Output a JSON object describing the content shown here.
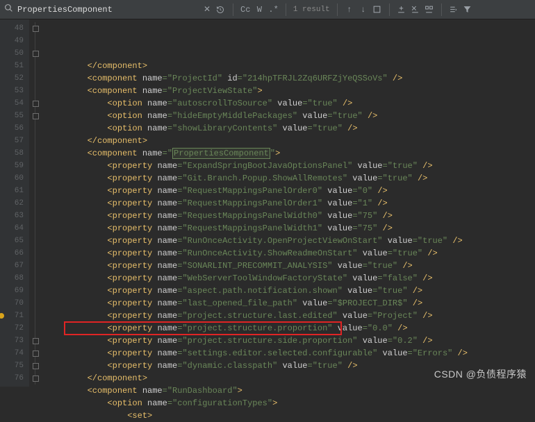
{
  "toolbar": {
    "search_value": "PropertiesComponent",
    "case_label": "Cc",
    "word_label": "W",
    "regex_label": ".*",
    "results": "1 result"
  },
  "gutter": {
    "start": 48,
    "end": 76,
    "breakpoint_line": 71
  },
  "code_lines": [
    {
      "indent": 4,
      "kind": "close",
      "tag": "component"
    },
    {
      "indent": 4,
      "kind": "self",
      "tag": "component",
      "attrs": [
        [
          "name",
          "ProjectId"
        ],
        [
          "id",
          "214hpTFRJL2Zq6URFZjYeQSSoVs"
        ]
      ]
    },
    {
      "indent": 4,
      "kind": "open",
      "tag": "component",
      "attrs": [
        [
          "name",
          "ProjectViewState"
        ]
      ]
    },
    {
      "indent": 6,
      "kind": "self",
      "tag": "option",
      "attrs": [
        [
          "name",
          "autoscrollToSource"
        ],
        [
          "value",
          "true"
        ]
      ]
    },
    {
      "indent": 6,
      "kind": "self",
      "tag": "option",
      "attrs": [
        [
          "name",
          "hideEmptyMiddlePackages"
        ],
        [
          "value",
          "true"
        ]
      ]
    },
    {
      "indent": 6,
      "kind": "self",
      "tag": "option",
      "attrs": [
        [
          "name",
          "showLibraryContents"
        ],
        [
          "value",
          "true"
        ]
      ]
    },
    {
      "indent": 4,
      "kind": "close",
      "tag": "component"
    },
    {
      "indent": 4,
      "kind": "open",
      "tag": "component",
      "attrs": [
        [
          "name",
          "PropertiesComponent"
        ]
      ],
      "highlight_attr_value": 0
    },
    {
      "indent": 6,
      "kind": "self",
      "tag": "property",
      "attrs": [
        [
          "name",
          "ExpandSpringBootJavaOptionsPanel"
        ],
        [
          "value",
          "true"
        ]
      ]
    },
    {
      "indent": 6,
      "kind": "self",
      "tag": "property",
      "attrs": [
        [
          "name",
          "Git.Branch.Popup.ShowAllRemotes"
        ],
        [
          "value",
          "true"
        ]
      ]
    },
    {
      "indent": 6,
      "kind": "self",
      "tag": "property",
      "attrs": [
        [
          "name",
          "RequestMappingsPanelOrder0"
        ],
        [
          "value",
          "0"
        ]
      ]
    },
    {
      "indent": 6,
      "kind": "self",
      "tag": "property",
      "attrs": [
        [
          "name",
          "RequestMappingsPanelOrder1"
        ],
        [
          "value",
          "1"
        ]
      ]
    },
    {
      "indent": 6,
      "kind": "self",
      "tag": "property",
      "attrs": [
        [
          "name",
          "RequestMappingsPanelWidth0"
        ],
        [
          "value",
          "75"
        ]
      ]
    },
    {
      "indent": 6,
      "kind": "self",
      "tag": "property",
      "attrs": [
        [
          "name",
          "RequestMappingsPanelWidth1"
        ],
        [
          "value",
          "75"
        ]
      ]
    },
    {
      "indent": 6,
      "kind": "self",
      "tag": "property",
      "attrs": [
        [
          "name",
          "RunOnceActivity.OpenProjectViewOnStart"
        ],
        [
          "value",
          "true"
        ]
      ]
    },
    {
      "indent": 6,
      "kind": "self",
      "tag": "property",
      "attrs": [
        [
          "name",
          "RunOnceActivity.ShowReadmeOnStart"
        ],
        [
          "value",
          "true"
        ]
      ]
    },
    {
      "indent": 6,
      "kind": "self",
      "tag": "property",
      "attrs": [
        [
          "name",
          "SONARLINT_PRECOMMIT_ANALYSIS"
        ],
        [
          "value",
          "true"
        ]
      ]
    },
    {
      "indent": 6,
      "kind": "self",
      "tag": "property",
      "attrs": [
        [
          "name",
          "WebServerToolWindowFactoryState"
        ],
        [
          "value",
          "false"
        ]
      ]
    },
    {
      "indent": 6,
      "kind": "self",
      "tag": "property",
      "attrs": [
        [
          "name",
          "aspect.path.notification.shown"
        ],
        [
          "value",
          "true"
        ]
      ]
    },
    {
      "indent": 6,
      "kind": "self",
      "tag": "property",
      "attrs": [
        [
          "name",
          "last_opened_file_path"
        ],
        [
          "value",
          "$PROJECT_DIR$"
        ]
      ]
    },
    {
      "indent": 6,
      "kind": "self",
      "tag": "property",
      "attrs": [
        [
          "name",
          "project.structure.last.edited"
        ],
        [
          "value",
          "Project"
        ]
      ]
    },
    {
      "indent": 6,
      "kind": "self",
      "tag": "property",
      "attrs": [
        [
          "name",
          "project.structure.proportion"
        ],
        [
          "value",
          "0.0"
        ]
      ]
    },
    {
      "indent": 6,
      "kind": "self",
      "tag": "property",
      "attrs": [
        [
          "name",
          "project.structure.side.proportion"
        ],
        [
          "value",
          "0.2"
        ]
      ]
    },
    {
      "indent": 6,
      "kind": "self",
      "tag": "property",
      "attrs": [
        [
          "name",
          "settings.editor.selected.configurable"
        ],
        [
          "value",
          "Errors"
        ]
      ]
    },
    {
      "indent": 6,
      "kind": "self",
      "tag": "property",
      "attrs": [
        [
          "name",
          "dynamic.classpath"
        ],
        [
          "value",
          "true"
        ]
      ],
      "red_box": true
    },
    {
      "indent": 4,
      "kind": "close",
      "tag": "component"
    },
    {
      "indent": 4,
      "kind": "open",
      "tag": "component",
      "attrs": [
        [
          "name",
          "RunDashboard"
        ]
      ]
    },
    {
      "indent": 6,
      "kind": "open",
      "tag": "option",
      "attrs": [
        [
          "name",
          "configurationTypes"
        ]
      ]
    },
    {
      "indent": 8,
      "kind": "open",
      "tag": "set"
    }
  ],
  "watermark": "CSDN @负债程序猿"
}
